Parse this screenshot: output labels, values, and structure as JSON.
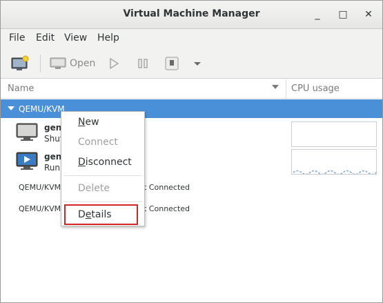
{
  "window": {
    "title": "Virtual Machine Manager",
    "minimize_glyph": "_",
    "maximize_glyph": "□",
    "close_glyph": "✕"
  },
  "menubar": {
    "file": "File",
    "edit": "Edit",
    "view": "View",
    "help": "Help"
  },
  "toolbar": {
    "new_vm_icon": "new-vm-icon",
    "open_label": "Open",
    "run_icon": "play-icon",
    "pause_icon": "pause-icon",
    "shutdown_icon": "shutdown-icon",
    "menu_icon": "chevron-down-icon"
  },
  "list_header": {
    "name": "Name",
    "cpu": "CPU usage"
  },
  "connection": {
    "label": "QEMU/KVM"
  },
  "vms": [
    {
      "name": "gene",
      "status": "Shut",
      "icon": "monitor-off-icon"
    },
    {
      "name": "gene",
      "status": "Runn",
      "icon": "monitor-play-icon"
    }
  ],
  "other_connections": [
    {
      "name": "QEMU/KVM",
      "status": "t Connected"
    },
    {
      "name": "QEMU/KVM",
      "status": "t Connected"
    }
  ],
  "context_menu": {
    "new": "New",
    "connect": "Connect",
    "disconnect": "Disconnect",
    "delete": "Delete",
    "details": "Details"
  },
  "colors": {
    "selection": "#4a90d9",
    "highlight_box": "#d42424"
  }
}
